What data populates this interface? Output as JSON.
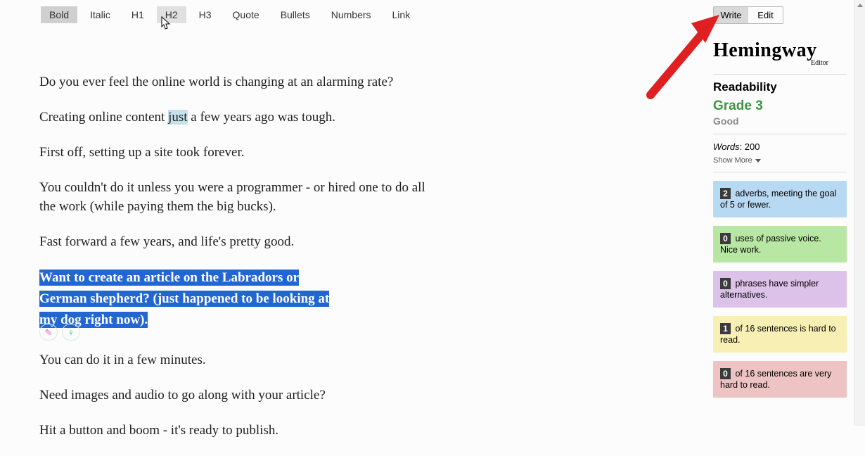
{
  "toolbar": {
    "bold": "Bold",
    "italic": "Italic",
    "h1": "H1",
    "h2": "H2",
    "h3": "H3",
    "quote": "Quote",
    "bullets": "Bullets",
    "numbers": "Numbers",
    "link": "Link"
  },
  "doc": {
    "p1": "Do you ever feel the online world is changing at an alarming rate?",
    "p2a": "Creating online content ",
    "p2_adv": "just",
    "p2b": " a few years ago was tough.",
    "p3": "First off, setting up a site took forever.",
    "p4": "You couldn't do it unless you were a programmer - or hired one to do all the work (while paying them the big bucks).",
    "p5": "Fast forward a few years, and life's pretty good.",
    "sel_l1": "Want to create an article on the Labradors or",
    "sel_l2": "German shepherd? (just happened to be looking at",
    "sel_l3": "my dog right now).",
    "p7": "You can do it in a few minutes.",
    "p8": "Need images and audio to go along with your article?",
    "p9": "Hit a button and boom - it's ready to publish."
  },
  "pills": {
    "a": "✎",
    "b": "♀"
  },
  "mode": {
    "write": "Write",
    "edit": "Edit"
  },
  "brand": {
    "big": "Hemingway",
    "sub": "Editor"
  },
  "readability": {
    "title": "Readability",
    "grade": "Grade 3",
    "good": "Good",
    "words_label": "Words",
    "words_value": "200",
    "show_more": "Show More"
  },
  "cards": {
    "adverbs": {
      "n": "2",
      "text": " adverbs, meeting the goal of 5 or fewer."
    },
    "passive": {
      "n": "0",
      "text": " uses of passive voice. Nice work."
    },
    "simpler": {
      "n": "0",
      "text": " phrases have simpler alternatives."
    },
    "hard": {
      "n": "1",
      "text": " of 16 sentences is hard to read."
    },
    "veryhard": {
      "n": "0",
      "text": " of 16 sentences are very hard to read."
    }
  }
}
